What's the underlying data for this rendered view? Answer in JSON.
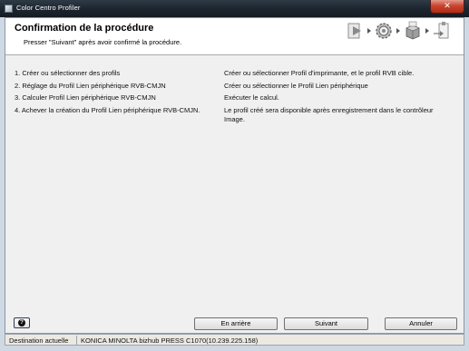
{
  "window": {
    "title": "Color Centro Profiler",
    "close_glyph": "✕"
  },
  "header": {
    "title": "Confirmation de la procédure",
    "subtitle": "Presser \"Suivant\" après avoir confirmé la procédure.",
    "step_icons": [
      "play-step-icon",
      "gear-step-icon",
      "package-step-icon",
      "export-step-icon"
    ]
  },
  "procedure": [
    {
      "step": "1. Créer ou sélectionner des profils",
      "description": "Créer ou sélectionner Profil d'imprimante, et le profil RVB cible."
    },
    {
      "step": "2. Réglage du Profil Lien périphérique RVB-CMJN",
      "description": "Créer ou sélectionner le Profil Lien périphérique"
    },
    {
      "step": "3. Calculer Profil Lien périphérique RVB-CMJN",
      "description": "Exécuter le calcul."
    },
    {
      "step": "4. Achever la création du Profil Lien périphérique RVB-CMJN.",
      "description": "Le profil créé sera disponible après enregistrement dans le contrôleur Image."
    }
  ],
  "footer": {
    "help_glyph": "?",
    "back_label": "En arrière",
    "next_label": "Suivant",
    "cancel_label": "Annuler"
  },
  "status": {
    "label": "Destination actuelle",
    "value": "KONICA MINOLTA bizhub PRESS C1070(10.239.225.158)"
  }
}
